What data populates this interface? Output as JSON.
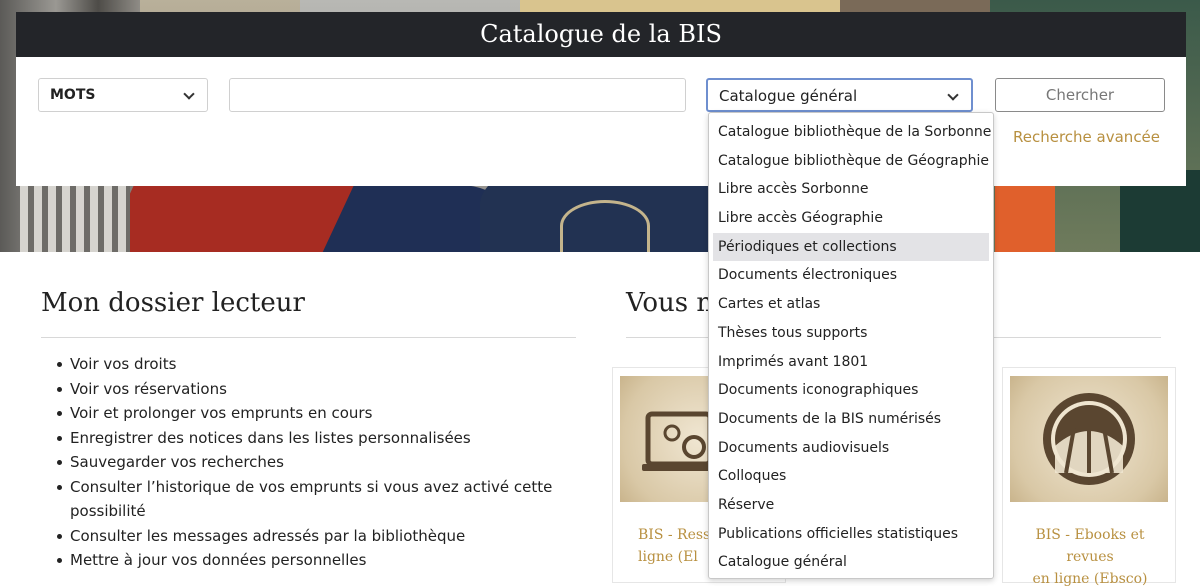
{
  "header": {
    "title": "Catalogue de la BIS"
  },
  "search": {
    "type_select": "MOTS",
    "query_value": "",
    "catalog_select": "Catalogue général",
    "search_button": "Chercher",
    "advanced_link": "Recherche avancée"
  },
  "catalog_options": [
    "Catalogue bibliothèque de la Sorbonne",
    "Catalogue bibliothèque de Géographie",
    "Libre accès Sorbonne",
    "Libre accès Géographie",
    "Périodiques et collections",
    "Documents électroniques",
    "Cartes et atlas",
    "Thèses tous supports",
    "Imprimés avant 1801",
    "Documents iconographiques",
    "Documents de la BIS numérisés",
    "Documents audiovisuels",
    "Colloques",
    "Réserve",
    "Publications officielles statistiques",
    "Catalogue général"
  ],
  "highlighted_option": "Périodiques et collections",
  "dossier": {
    "title": "Mon dossier lecteur",
    "items": [
      "Voir vos droits",
      "Voir vos réservations",
      "Voir et prolonger vos emprunts en cours",
      "Enregistrer des notices dans les listes personnalisées",
      "Sauvegarder vos recherches",
      "Consulter l’historique de vos emprunts si vous avez activé cette possibilité",
      "Consulter les messages adressés par la bibliothèque",
      "Mettre à jour vos données personnelles"
    ]
  },
  "resources": {
    "title_visible": "Vous n",
    "cards": [
      {
        "line1": "BIS - Resso",
        "line2": "ligne (El",
        "icon": "computer-gears-icon"
      },
      {
        "line1": "BIS - Ebooks et revues",
        "line2": "en ligne (Ebsco)",
        "icon": "ebsco-logo-icon"
      }
    ]
  },
  "colors": {
    "header_bg": "#232529",
    "link_gold": "#b89040",
    "focus_blue": "#6f8fcf"
  }
}
